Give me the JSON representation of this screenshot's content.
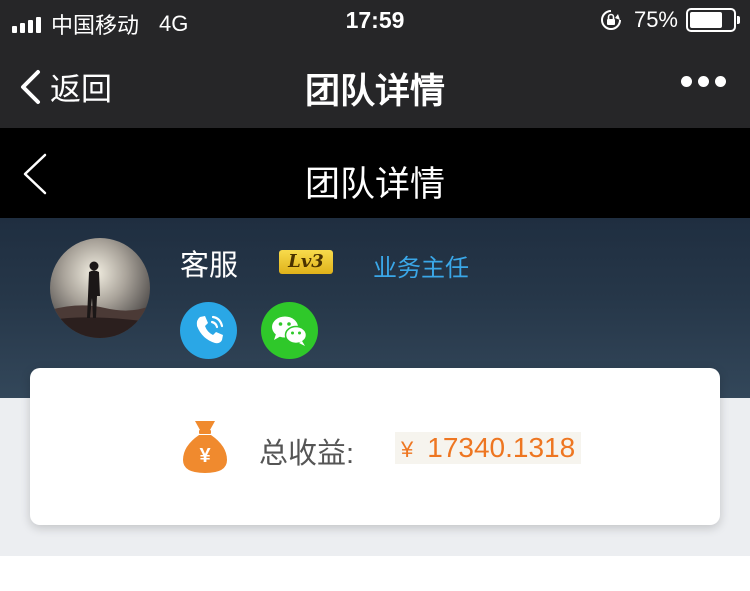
{
  "status_bar": {
    "carrier": "中国移动",
    "network": "4G",
    "time": "17:59",
    "battery_percent": "75%",
    "battery_level": 0.75
  },
  "wechat_nav": {
    "back_label": "返回",
    "title": "团队详情",
    "more_icon": "ellipsis-icon"
  },
  "page_header": {
    "title": "团队详情",
    "back_icon": "chevron-left-icon"
  },
  "profile": {
    "name": "客服",
    "level": "Lv3",
    "role": "业务主任",
    "actions": [
      {
        "icon": "phone-icon",
        "color": "#2aa7e6"
      },
      {
        "icon": "wechat-icon",
        "color": "#2fc82a"
      }
    ]
  },
  "earnings": {
    "label": "总收益:",
    "currency": "¥",
    "amount": "17340.1318",
    "accent_color": "#ee7621"
  }
}
